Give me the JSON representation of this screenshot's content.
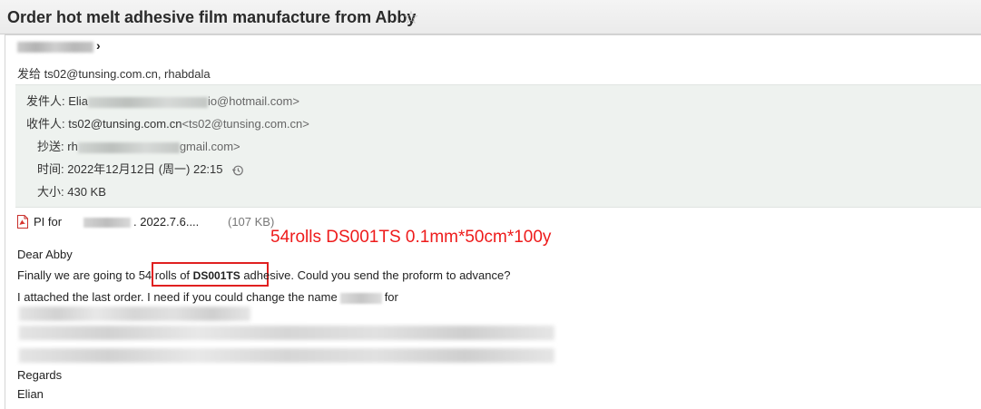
{
  "header": {
    "subject": "Order hot melt adhesive film manufacture from Abby",
    "star_icon": "star-outline-icon"
  },
  "summary": {
    "sender_tail": "›",
    "recipients": "发给 ts02@tunsing.com.cn, rhabdala"
  },
  "details": {
    "from_label": "发件人:",
    "from_start": "Elia",
    "from_end": "io@hotmail.com>",
    "to_label": "收件人:",
    "to_name": "ts02@tunsing.com.cn",
    "to_addr": "<ts02@tunsing.com.cn>",
    "cc_label": "抄送:",
    "cc_start": "rh",
    "cc_end": "gmail.com>",
    "time_label": "时间:",
    "time_value": "2022年12月12日 (周一) 22:15",
    "size_label": "大小:",
    "size_value": "430 KB"
  },
  "attachment": {
    "name_start": "PI for",
    "name_end": ". 2022.7.6....",
    "size": "(107 KB)"
  },
  "annotation": {
    "callout": "54rolls DS001TS 0.1mm*50cm*100y"
  },
  "body": {
    "greeting": "Dear Abby",
    "line1_before": "Finally we are going to ",
    "line1_highlight": "54 rolls of ",
    "line1_code": "DS001TS",
    "line1_after": " adhesive. Could you send the proform to advance?",
    "line2_before": "I attached the last order. I need if you could change the name",
    "line2_after": "for",
    "regards": "Regards",
    "signature": "Elian"
  },
  "colors": {
    "annotation_red": "#ee1b1b",
    "detail_bg": "#eef2ef"
  }
}
